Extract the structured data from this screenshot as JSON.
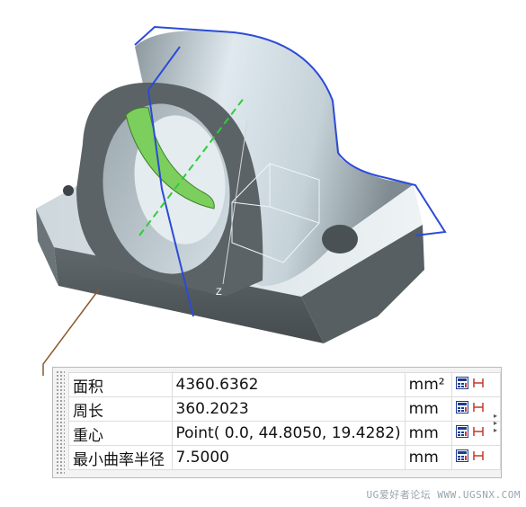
{
  "measure": {
    "rows": [
      {
        "label": "面积",
        "value": "4360.6362",
        "unit": "mm²"
      },
      {
        "label": "周长",
        "value": "360.2023",
        "unit": "mm"
      },
      {
        "label": "重心",
        "value": "Point( 0.0, 44.8050, 19.4282)",
        "unit": "mm"
      },
      {
        "label": "最小曲率半径",
        "value": "7.5000",
        "unit": "mm"
      }
    ]
  },
  "viewport": {
    "axis_label": "Z"
  },
  "watermark": "UG爱好者论坛 WWW.UGSNX.COM",
  "colors": {
    "highlight_edge": "#2b4bd6",
    "selected_face": "#7ccf5c",
    "leader_line": "#8a5a2b",
    "part_light": "#cfdde4",
    "part_dark": "#4a5154"
  }
}
